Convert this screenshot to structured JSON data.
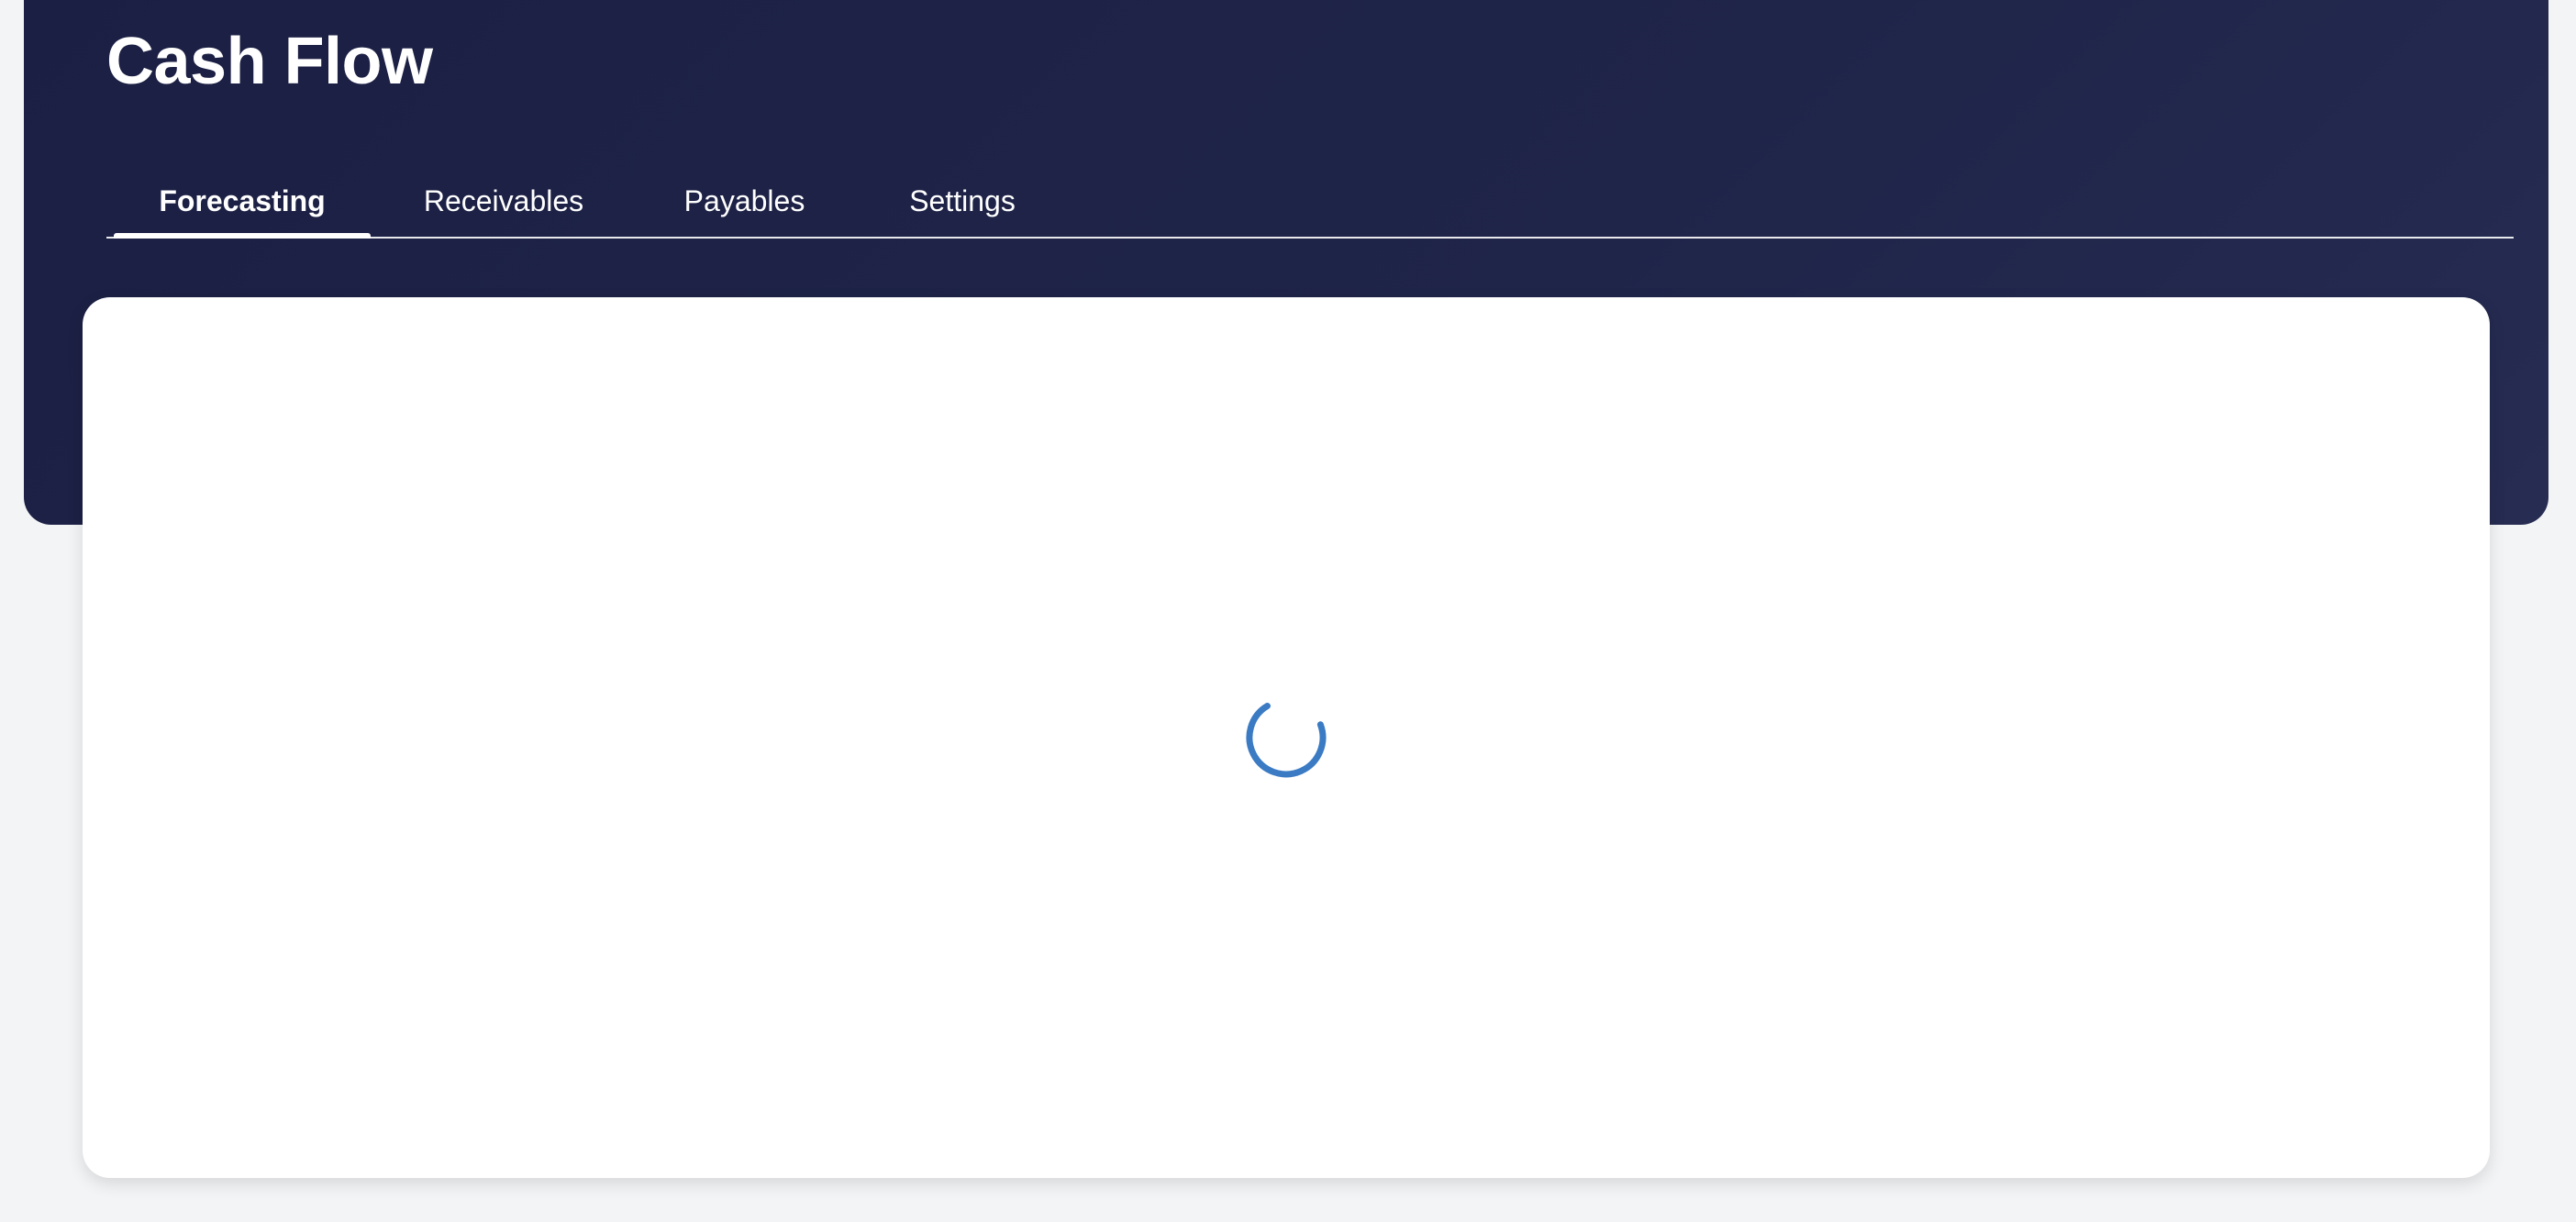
{
  "header": {
    "title": "Cash Flow"
  },
  "tabs": [
    {
      "label": "Forecasting",
      "active": true
    },
    {
      "label": "Receivables",
      "active": false
    },
    {
      "label": "Payables",
      "active": false
    },
    {
      "label": "Settings",
      "active": false
    }
  ],
  "main": {
    "state": "loading",
    "spinner_icon": "loading-spinner-icon"
  },
  "colors": {
    "header_background": "#1f2549",
    "page_background": "#f3f4f6",
    "card_background": "#ffffff",
    "spinner": "#3b7bc4"
  }
}
